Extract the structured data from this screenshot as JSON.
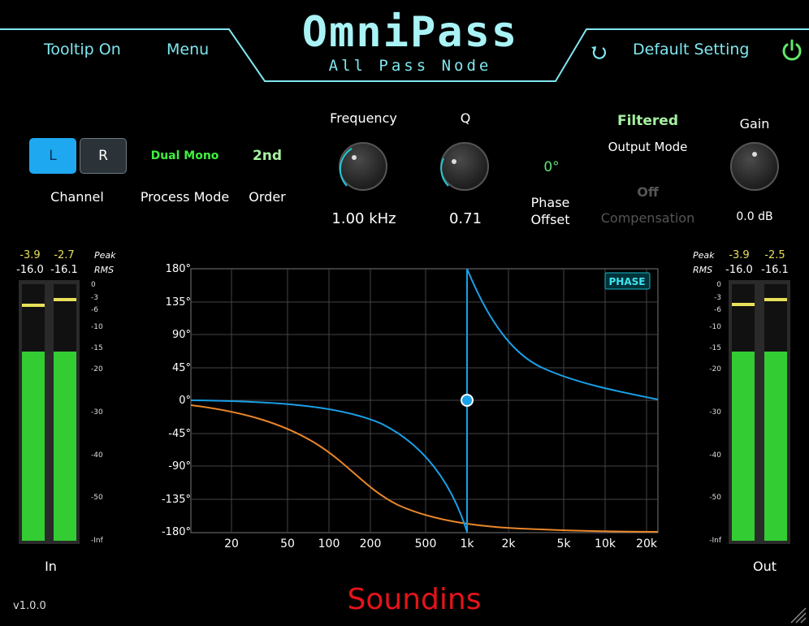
{
  "header": {
    "title": "OmniPass",
    "subtitle": "All Pass Node",
    "tooltip_label": "Tooltip On",
    "menu_label": "Menu",
    "default_label": "Default Setting"
  },
  "channel": {
    "left": "L",
    "right": "R",
    "label": "Channel",
    "selected": "L"
  },
  "process_mode": {
    "value": "Dual Mono",
    "label": "Process Mode"
  },
  "order": {
    "value": "2nd",
    "label": "Order"
  },
  "frequency": {
    "label": "Frequency",
    "value": "1.00 kHz"
  },
  "q": {
    "label": "Q",
    "value": "0.71"
  },
  "phase_offset": {
    "value": "0°",
    "label_line1": "Phase",
    "label_line2": "Offset"
  },
  "output_mode": {
    "value": "Filtered",
    "label": "Output Mode"
  },
  "compensation": {
    "value": "Off",
    "label": "Compensation"
  },
  "gain": {
    "label": "Gain",
    "value": "0.0 dB"
  },
  "meters": {
    "peak_label": "Peak",
    "rms_label": "RMS",
    "scale": [
      "0",
      "-3",
      "-6",
      "-10",
      "-15",
      "-20",
      "-30",
      "-40",
      "-50",
      "-Inf"
    ],
    "in": {
      "label": "In",
      "peak": [
        "-3.9",
        "-2.7"
      ],
      "rms": [
        "-16.0",
        "-16.1"
      ]
    },
    "out": {
      "label": "Out",
      "peak": [
        "-3.9",
        "-2.5"
      ],
      "rms": [
        "-16.0",
        "-16.1"
      ]
    }
  },
  "graph": {
    "badge": "PHASE",
    "y_ticks": [
      "180°",
      "135°",
      "90°",
      "45°",
      "0°",
      "-45°",
      "-90°",
      "-135°",
      "-180°"
    ],
    "x_ticks": [
      "20",
      "50",
      "100",
      "200",
      "500",
      "1k",
      "2k",
      "5k",
      "10k",
      "20k"
    ]
  },
  "footer": {
    "version": "v1.0.0",
    "brand": "Soundins"
  },
  "colors": {
    "accent": "#7fe7ef",
    "green": "#3ef03e",
    "blue": "#1aa0e8",
    "orange": "#e8862a",
    "brand": "#e3141a"
  }
}
